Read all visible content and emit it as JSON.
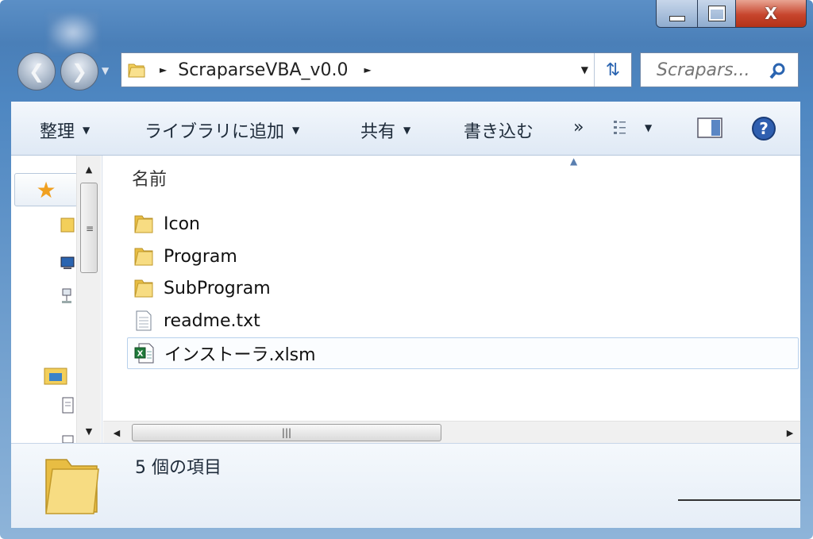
{
  "window": {
    "controls": {
      "minimize": "minimize",
      "maximize": "maximize",
      "close": "X"
    }
  },
  "address_bar": {
    "path": "ScraparseVBA_v0.0"
  },
  "search": {
    "placeholder": "Scrapars..."
  },
  "toolbar": {
    "organize": "整理",
    "add_to_library": "ライブラリに追加",
    "share": "共有",
    "burn": "書き込む",
    "more": "»"
  },
  "file_list": {
    "column_header": "名前",
    "items": [
      {
        "name": "Icon",
        "type": "folder"
      },
      {
        "name": "Program",
        "type": "folder"
      },
      {
        "name": "SubProgram",
        "type": "folder"
      },
      {
        "name": "readme.txt",
        "type": "text"
      },
      {
        "name": "インストーラ.xlsm",
        "type": "excel",
        "selected": true
      }
    ]
  },
  "details_pane": {
    "count": "5 個の項目"
  },
  "colors": {
    "window_frame": "#4d86c1",
    "accent_blue": "#2a64b0",
    "close_red": "#c7452d",
    "folder_yellow": "#f3cf5a"
  }
}
